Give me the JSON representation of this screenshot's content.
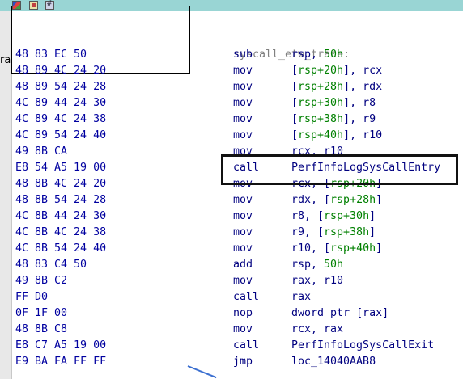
{
  "toolbar": {
    "icons": [
      "color-palette-icon",
      "edit-graph-icon",
      "grid-icon"
    ],
    "accent": "#99d5d4"
  },
  "left_fragment": "ra",
  "function_label": "syscall_etw_trace:",
  "colors": {
    "bytes": "#0000a0",
    "mnemonic": "#000080",
    "number": "#008000",
    "label": "#808080"
  },
  "instructions": [
    {
      "bytes": "48 83 EC 50",
      "mn": "sub",
      "ops": [
        {
          "t": "rsp, "
        },
        {
          "t": "50h",
          "num": true
        }
      ]
    },
    {
      "bytes": "48 89 4C 24 20",
      "mn": "mov",
      "ops": [
        {
          "t": "["
        },
        {
          "t": "rsp+20h",
          "num": true
        },
        {
          "t": "], rcx"
        }
      ]
    },
    {
      "bytes": "48 89 54 24 28",
      "mn": "mov",
      "ops": [
        {
          "t": "["
        },
        {
          "t": "rsp+28h",
          "num": true
        },
        {
          "t": "], rdx"
        }
      ]
    },
    {
      "bytes": "4C 89 44 24 30",
      "mn": "mov",
      "ops": [
        {
          "t": "["
        },
        {
          "t": "rsp+30h",
          "num": true
        },
        {
          "t": "], r8"
        }
      ]
    },
    {
      "bytes": "4C 89 4C 24 38",
      "mn": "mov",
      "ops": [
        {
          "t": "["
        },
        {
          "t": "rsp+38h",
          "num": true
        },
        {
          "t": "], r9"
        }
      ]
    },
    {
      "bytes": "4C 89 54 24 40",
      "mn": "mov",
      "ops": [
        {
          "t": "["
        },
        {
          "t": "rsp+40h",
          "num": true
        },
        {
          "t": "], r10"
        }
      ]
    },
    {
      "bytes": "49 8B CA",
      "mn": "mov",
      "ops": [
        {
          "t": "rcx, r10"
        }
      ]
    },
    {
      "bytes": "E8 54 A5 19 00",
      "mn": "call",
      "ops": [
        {
          "t": "PerfInfoLogSysCallEntry"
        }
      ]
    },
    {
      "bytes": "48 8B 4C 24 20",
      "mn": "mov",
      "ops": [
        {
          "t": "rcx, ["
        },
        {
          "t": "rsp+20h",
          "num": true
        },
        {
          "t": "]"
        }
      ]
    },
    {
      "bytes": "48 8B 54 24 28",
      "mn": "mov",
      "ops": [
        {
          "t": "rdx, ["
        },
        {
          "t": "rsp+28h",
          "num": true
        },
        {
          "t": "]"
        }
      ]
    },
    {
      "bytes": "4C 8B 44 24 30",
      "mn": "mov",
      "ops": [
        {
          "t": "r8, ["
        },
        {
          "t": "rsp+30h",
          "num": true
        },
        {
          "t": "]"
        }
      ]
    },
    {
      "bytes": "4C 8B 4C 24 38",
      "mn": "mov",
      "ops": [
        {
          "t": "r9, ["
        },
        {
          "t": "rsp+38h",
          "num": true
        },
        {
          "t": "]"
        }
      ]
    },
    {
      "bytes": "4C 8B 54 24 40",
      "mn": "mov",
      "ops": [
        {
          "t": "r10, ["
        },
        {
          "t": "rsp+40h",
          "num": true
        },
        {
          "t": "]"
        }
      ]
    },
    {
      "bytes": "48 83 C4 50",
      "mn": "add",
      "ops": [
        {
          "t": "rsp, "
        },
        {
          "t": "50h",
          "num": true
        }
      ]
    },
    {
      "bytes": "49 8B C2",
      "mn": "mov",
      "ops": [
        {
          "t": "rax, r10"
        }
      ]
    },
    {
      "bytes": "FF D0",
      "mn": "call",
      "ops": [
        {
          "t": "rax"
        }
      ]
    },
    {
      "bytes": "0F 1F 00",
      "mn": "nop",
      "ops": [
        {
          "t": "dword ptr [rax]"
        }
      ]
    },
    {
      "bytes": "48 8B C8",
      "mn": "mov",
      "ops": [
        {
          "t": "rcx, rax"
        }
      ]
    },
    {
      "bytes": "E8 C7 A5 19 00",
      "mn": "call",
      "ops": [
        {
          "t": "PerfInfoLogSysCallExit"
        }
      ]
    },
    {
      "bytes": "E9 BA FA FF FF",
      "mn": "jmp",
      "ops": [
        {
          "t": "loc_14040AAB8"
        }
      ]
    }
  ]
}
